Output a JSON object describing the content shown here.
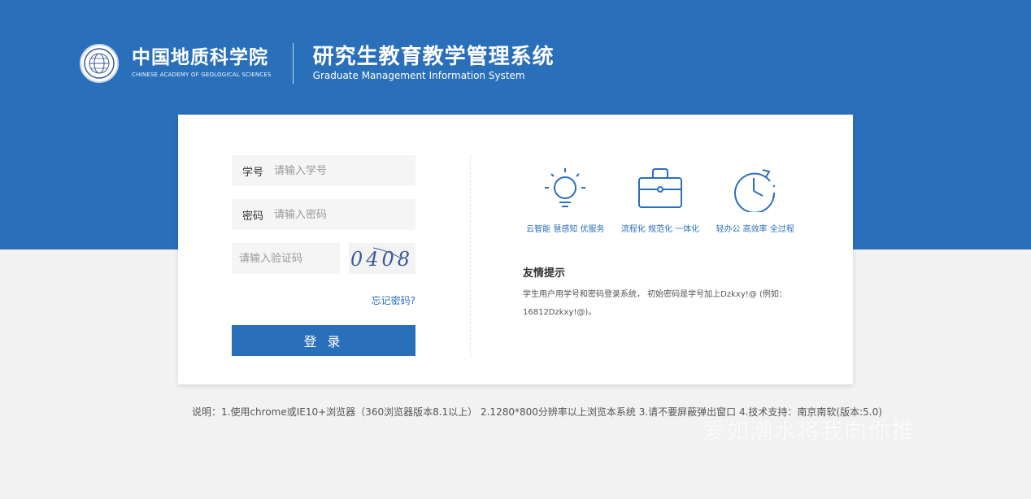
{
  "header": {
    "institution_cn": "中国地质科学院",
    "institution_en": "CHINESE ACADEMY OF GEOLOGICAL SCIENCES",
    "system_cn": "研究生教育教学管理系统",
    "system_en": "Graduate Management Information System",
    "logo_icon": "academy-emblem"
  },
  "login": {
    "student_id_label": "学号",
    "student_id_placeholder": "请输入学号",
    "password_label": "密码",
    "password_placeholder": "请输入密码",
    "captcha_placeholder": "请输入验证码",
    "captcha_code": "0408",
    "forgot_link": "忘记密码?",
    "submit_label": "登 录"
  },
  "features": [
    {
      "icon": "lightbulb-icon",
      "label": "云智能 慧感知 优服务"
    },
    {
      "icon": "briefcase-icon",
      "label": "流程化 规范化 一体化"
    },
    {
      "icon": "clock-icon",
      "label": "轻办公 高效率 全过程"
    }
  ],
  "tips": {
    "title": "友情提示",
    "text": "学生用户用学号和密码登录系统， 初始密码是学号加上Dzkxy!@ (例如：16812Dzkxy!@)。"
  },
  "footnote": "说明：1.使用chrome或IE10+浏览器（360浏览器版本8.1以上） 2.1280*800分辨率以上浏览本系统 3.请不要屏蔽弹出窗口 4.技术支持：南京南软(版本:5.0)",
  "watermark": "爱如潮水将我向你推",
  "colors": {
    "brand_blue": "#2a6fba",
    "background": "#f2f2f2",
    "card": "#ffffff"
  }
}
